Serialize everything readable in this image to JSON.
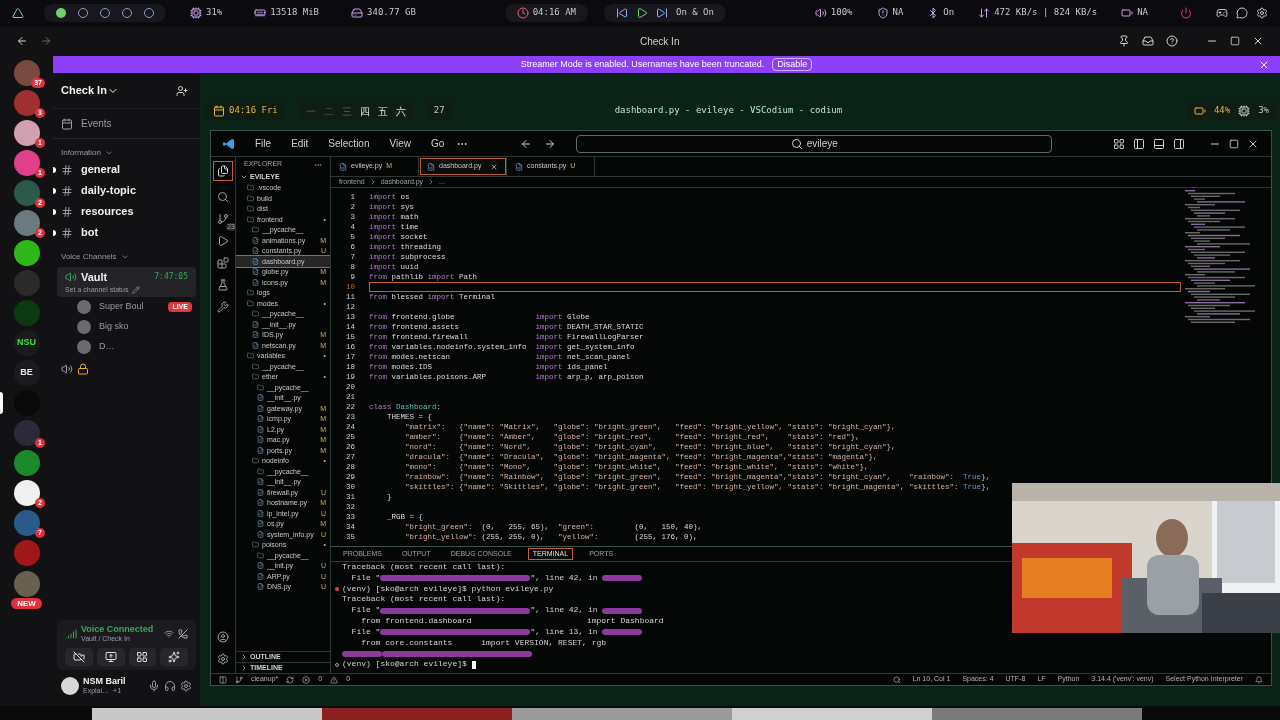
{
  "system_bar": {
    "workspaces": [
      {
        "selected": true
      },
      {
        "selected": false
      },
      {
        "selected": false
      },
      {
        "selected": false
      },
      {
        "selected": false
      }
    ],
    "stats": [
      {
        "kind": "cpu",
        "text": "31%"
      },
      {
        "kind": "memory",
        "text": "13518 MiB"
      },
      {
        "kind": "disk",
        "text": "340.77 GB"
      }
    ],
    "clock": "04:16 AM",
    "media": "On & On",
    "indicators": [
      {
        "kind": "volume",
        "text": "100%"
      },
      {
        "kind": "vpn",
        "text": "NA"
      },
      {
        "kind": "bluetooth",
        "text": "On"
      },
      {
        "kind": "network",
        "text": "472 KB/s | 824 KB/s"
      },
      {
        "kind": "battery",
        "text": "NA"
      }
    ]
  },
  "discord": {
    "window_title": "Check In",
    "banner": {
      "text": "Streamer Mode is enabled. Usernames have been truncated.",
      "button": "Disable"
    },
    "servers": [
      {
        "kind": "avatar",
        "color": "#7a4a40",
        "badge": "37",
        "selected": false
      },
      {
        "kind": "avatar",
        "color": "#a03030",
        "badge": "3",
        "selected": false
      },
      {
        "kind": "avatar",
        "color": "#d0a0b0",
        "badge": "1",
        "selected": false
      },
      {
        "kind": "avatar",
        "color": "#e0408a",
        "badge": "1",
        "selected": false
      },
      {
        "kind": "avatar",
        "color": "#2a5a4a",
        "badge": "2",
        "selected": false
      },
      {
        "kind": "avatar",
        "color": "#6a7a80",
        "badge": "2",
        "selected": false
      },
      {
        "kind": "avatar",
        "color": "#2fb81a",
        "selected": false
      },
      {
        "kind": "avatar",
        "color": "#2a2a2a",
        "selected": false
      },
      {
        "kind": "avatar",
        "color": "#0c3a10",
        "selected": false
      },
      {
        "kind": "text",
        "label": "NSU",
        "color": "#3adf3a",
        "selected": false
      },
      {
        "kind": "text",
        "label": "BE",
        "color": "#e6e6e6",
        "selected": false
      },
      {
        "kind": "avatar",
        "color": "#0a0a0a",
        "selected": true
      },
      {
        "kind": "avatar",
        "color": "#2a2a3a",
        "badge": "1",
        "selected": false
      },
      {
        "kind": "avatar",
        "color": "#1a8a2a",
        "selected": false
      },
      {
        "kind": "avatar",
        "color": "#f0f0f0",
        "badge": "2",
        "selected": false
      },
      {
        "kind": "avatar",
        "color": "#2a5a8a",
        "badge": "7",
        "selected": false
      },
      {
        "kind": "avatar",
        "color": "#a01818",
        "selected": false
      },
      {
        "kind": "avatar",
        "color": "#6a6050",
        "badge": "NEW",
        "selected": false
      }
    ],
    "server_name": "Check In",
    "events": "Events",
    "category": "Information",
    "channels": [
      {
        "name": "general",
        "unread": true
      },
      {
        "name": "daily-topic",
        "unread": true
      },
      {
        "name": "resources",
        "unread": true
      },
      {
        "name": "bot",
        "unread": true
      }
    ],
    "voice": {
      "category": "Voice Channels",
      "channel": "Vault",
      "timer": "7:47:05",
      "status_hint": "Set a channel status",
      "members": [
        {
          "name": "Super Boul",
          "live": true,
          "live_label": "LIVE"
        },
        {
          "name": "Big sko",
          "live": false
        },
        {
          "name": "D…",
          "live": false
        }
      ]
    },
    "voice_panel": {
      "title": "Voice Connected",
      "subtitle": "Vault / Check In"
    },
    "user": {
      "name": "NSM Baril",
      "status": "Explai…",
      "extra": "+1"
    }
  },
  "waybar": {
    "clock": "04:16 Fri",
    "workspaces": [
      {
        "label": "一",
        "occupied": false
      },
      {
        "label": "二",
        "occupied": false
      },
      {
        "label": "三",
        "occupied": false
      },
      {
        "label": "四",
        "occupied": true
      },
      {
        "label": "五",
        "occupied": true
      },
      {
        "label": "六",
        "occupied": true
      }
    ],
    "count": "27",
    "title": "dashboard.py - evileye - VSCodium - codium",
    "battery": "44%",
    "cpu": "3%"
  },
  "vscode": {
    "menu": [
      "File",
      "Edit",
      "Selection",
      "View",
      "Go"
    ],
    "search": "evileye",
    "scm_badge": "23",
    "explorer": {
      "title": "EXPLORER",
      "root": "EVILEYE",
      "sections": [
        "OUTLINE",
        "TIMELINE"
      ],
      "tree": [
        {
          "name": ".vscode",
          "kind": "folder",
          "selected": false
        },
        {
          "name": "build",
          "kind": "folder",
          "selected": false
        },
        {
          "name": "dist",
          "kind": "folder",
          "selected": false
        },
        {
          "name": "frontend",
          "kind": "folder",
          "status": "•",
          "selected": false,
          "children": [
            {
              "name": "__pycache__",
              "kind": "folder",
              "selected": false
            },
            {
              "name": "animations.py",
              "kind": "file",
              "status": "M",
              "selected": false
            },
            {
              "name": "constants.py",
              "kind": "file",
              "status": "U",
              "selected": false
            },
            {
              "name": "dashboard.py",
              "kind": "file",
              "selected": true
            },
            {
              "name": "globe.py",
              "kind": "file",
              "status": "M",
              "selected": false
            },
            {
              "name": "icons.py",
              "kind": "file",
              "status": "M",
              "selected": false
            }
          ]
        },
        {
          "name": "logs",
          "kind": "folder",
          "selected": false
        },
        {
          "name": "modes",
          "kind": "folder",
          "status": "•",
          "selected": false,
          "children": [
            {
              "name": "__pycache__",
              "kind": "folder",
              "selected": false
            },
            {
              "name": "__init__.py",
              "kind": "file",
              "selected": false
            },
            {
              "name": "IDS.py",
              "kind": "file",
              "status": "M",
              "selected": false
            },
            {
              "name": "netscan.py",
              "kind": "file",
              "status": "M",
              "selected": false
            }
          ]
        },
        {
          "name": "variables",
          "kind": "folder",
          "status": "•",
          "selected": false,
          "children": [
            {
              "name": "__pycache__",
              "kind": "folder",
              "selected": false
            },
            {
              "name": "ether",
              "kind": "folder",
              "status": "•",
              "selected": false,
              "children": [
                {
                  "name": "__pycache__",
                  "kind": "folder",
                  "selected": false
                },
                {
                  "name": "__init__.py",
                  "kind": "file",
                  "selected": false
                },
                {
                  "name": "gateway.py",
                  "kind": "file",
                  "status": "M",
                  "selected": false
                },
                {
                  "name": "icmp.py",
                  "kind": "file",
                  "status": "M",
                  "selected": false
                },
                {
                  "name": "L2.py",
                  "kind": "file",
                  "status": "M",
                  "selected": false
                },
                {
                  "name": "mac.py",
                  "kind": "file",
                  "status": "M",
                  "selected": false
                },
                {
                  "name": "ports.py",
                  "kind": "file",
                  "status": "M",
                  "selected": false
                }
              ]
            },
            {
              "name": "nodeinfo",
              "kind": "folder",
              "status": "•",
              "selected": false,
              "children": [
                {
                  "name": "__pycache__",
                  "kind": "folder",
                  "selected": false
                },
                {
                  "name": "__init__.py",
                  "kind": "file",
                  "selected": false
                },
                {
                  "name": "firewall.py",
                  "kind": "file",
                  "status": "U",
                  "selected": false
                },
                {
                  "name": "hostname.py",
                  "kind": "file",
                  "status": "M",
                  "selected": false
                },
                {
                  "name": "ip_intel.py",
                  "kind": "file",
                  "status": "U",
                  "selected": false
                },
                {
                  "name": "os.py",
                  "kind": "file",
                  "status": "M",
                  "selected": false
                },
                {
                  "name": "system_info.py",
                  "kind": "file",
                  "status": "U",
                  "selected": false
                }
              ]
            },
            {
              "name": "poisons",
              "kind": "folder",
              "status": "•",
              "selected": false,
              "children": [
                {
                  "name": "__pycache__",
                  "kind": "folder",
                  "selected": false
                },
                {
                  "name": "__init.py",
                  "kind": "file",
                  "status": "U",
                  "selected": false
                },
                {
                  "name": "ARP.py",
                  "kind": "file",
                  "status": "U",
                  "selected": false
                },
                {
                  "name": "DNS.py",
                  "kind": "file",
                  "status": "U",
                  "selected": false
                }
              ]
            }
          ]
        }
      ]
    },
    "tabs": [
      {
        "label": "evileye.py",
        "status": "M",
        "selected": false
      },
      {
        "label": "dashboard.py",
        "selected": true
      },
      {
        "label": "constants.py",
        "status": "U",
        "selected": false
      }
    ],
    "breadcrumb": [
      "frontend",
      "dashboard.py",
      "..."
    ],
    "code": [
      {
        "n": "1",
        "selected": false,
        "s": [
          {
            "kind": "kw",
            "text": "import"
          },
          {
            "kind": "id",
            "text": " os"
          }
        ]
      },
      {
        "n": "2",
        "selected": false,
        "s": [
          {
            "kind": "kw",
            "text": "import"
          },
          {
            "kind": "id",
            "text": " sys"
          }
        ]
      },
      {
        "n": "3",
        "selected": false,
        "s": [
          {
            "kind": "kw",
            "text": "import"
          },
          {
            "kind": "id",
            "text": " math"
          }
        ]
      },
      {
        "n": "4",
        "selected": false,
        "s": [
          {
            "kind": "kw",
            "text": "import"
          },
          {
            "kind": "id",
            "text": " time"
          }
        ]
      },
      {
        "n": "5",
        "selected": false,
        "s": [
          {
            "kind": "kw",
            "text": "import"
          },
          {
            "kind": "id",
            "text": " socket"
          }
        ]
      },
      {
        "n": "6",
        "selected": false,
        "s": [
          {
            "kind": "kw",
            "text": "import"
          },
          {
            "kind": "id",
            "text": " threading"
          }
        ]
      },
      {
        "n": "7",
        "selected": false,
        "s": [
          {
            "kind": "kw",
            "text": "import"
          },
          {
            "kind": "id",
            "text": " subprocess"
          }
        ]
      },
      {
        "n": "8",
        "selected": false,
        "s": [
          {
            "kind": "kw",
            "text": "import"
          },
          {
            "kind": "id",
            "text": " uuid"
          }
        ]
      },
      {
        "n": "9",
        "selected": false,
        "s": [
          {
            "kind": "kw",
            "text": "from"
          },
          {
            "kind": "id",
            "text": " pathlib "
          },
          {
            "kind": "kw",
            "text": "import"
          },
          {
            "kind": "id",
            "text": " Path"
          }
        ]
      },
      {
        "n": "10",
        "selected": true
      },
      {
        "n": "11",
        "selected": false,
        "s": [
          {
            "kind": "kw",
            "text": "from"
          },
          {
            "kind": "id",
            "text": " blessed "
          },
          {
            "kind": "kw",
            "text": "import"
          },
          {
            "kind": "id",
            "text": " Terminal"
          }
        ]
      },
      {
        "n": "12",
        "selected": false
      },
      {
        "n": "13",
        "selected": false,
        "kind": "aligned",
        "s": [
          {
            "kind": "kw",
            "text": "from"
          },
          {
            "kind": "id",
            "text": " frontend.globe"
          },
          {
            "kind": "kw",
            "text": "import"
          },
          {
            "kind": "id",
            "text": " Globe"
          }
        ]
      },
      {
        "n": "14",
        "selected": false,
        "kind": "aligned",
        "s": [
          {
            "kind": "kw",
            "text": "from"
          },
          {
            "kind": "id",
            "text": " frontend.assets"
          },
          {
            "kind": "kw",
            "text": "import"
          },
          {
            "kind": "id",
            "text": " DEATH_STAR_STATIC"
          }
        ]
      },
      {
        "n": "15",
        "selected": false,
        "kind": "aligned",
        "s": [
          {
            "kind": "kw",
            "text": "from"
          },
          {
            "kind": "id",
            "text": " frontend.firewall"
          },
          {
            "kind": "kw",
            "text": "import"
          },
          {
            "kind": "id",
            "text": " FirewallLogParser"
          }
        ]
      },
      {
        "n": "16",
        "selected": false,
        "kind": "aligned",
        "s": [
          {
            "kind": "kw",
            "text": "from"
          },
          {
            "kind": "id",
            "text": " variables.nodeinfo.system_info"
          },
          {
            "kind": "kw",
            "text": "import"
          },
          {
            "kind": "id",
            "text": " get_system_info"
          }
        ]
      },
      {
        "n": "17",
        "selected": false,
        "kind": "aligned",
        "s": [
          {
            "kind": "kw",
            "text": "from"
          },
          {
            "kind": "id",
            "text": " modes.netscan"
          },
          {
            "kind": "kw",
            "text": "import"
          },
          {
            "kind": "id",
            "text": " net_scan_panel"
          }
        ]
      },
      {
        "n": "18",
        "selected": false,
        "kind": "aligned",
        "s": [
          {
            "kind": "kw",
            "text": "from"
          },
          {
            "kind": "id",
            "text": " modes.IDS"
          },
          {
            "kind": "kw",
            "text": "import"
          },
          {
            "kind": "id",
            "text": " ids_panel"
          }
        ]
      },
      {
        "n": "19",
        "selected": false,
        "kind": "aligned",
        "s": [
          {
            "kind": "kw",
            "text": "from"
          },
          {
            "kind": "id",
            "text": " variables.poisons.ARP"
          },
          {
            "kind": "kw",
            "text": "import"
          },
          {
            "kind": "id",
            "text": " arp_p, arp_poison"
          }
        ]
      },
      {
        "n": "20",
        "selected": false
      },
      {
        "n": "21",
        "selected": false
      },
      {
        "n": "22",
        "selected": false,
        "s": [
          {
            "kind": "kw",
            "text": "class"
          },
          {
            "kind": "cls",
            "text": " Dashboard"
          },
          {
            "kind": "id",
            "text": ":"
          }
        ]
      },
      {
        "n": "23",
        "selected": false,
        "s": [
          {
            "kind": "id",
            "text": "    THEMES = {"
          }
        ]
      },
      {
        "n": "24",
        "selected": false,
        "s": [
          {
            "kind": "str",
            "text": "        \"matrix\":   {\"name\": \"Matrix\",   \"globe\": \"bright_green\",   \"feed\": \"bright_yellow\", \"stats\": \"bright_cyan\"},"
          }
        ]
      },
      {
        "n": "25",
        "selected": false,
        "s": [
          {
            "kind": "str",
            "text": "        \"amber\":    {\"name\": \"Amber\",    \"globe\": \"bright_red\",     \"feed\": \"bright_red\",    \"stats\": \"red\"},"
          }
        ]
      },
      {
        "n": "26",
        "selected": false,
        "s": [
          {
            "kind": "str",
            "text": "        \"nord\":     {\"name\": \"Nord\",     \"globe\": \"bright_cyan\",    \"feed\": \"bright_blue\",   \"stats\": \"bright_cyan\"},"
          }
        ]
      },
      {
        "n": "27",
        "selected": false,
        "s": [
          {
            "kind": "str",
            "text": "        \"dracula\":  {\"name\": \"Dracula\",  \"globe\": \"bright_magenta\", \"feed\": \"bright_magenta\",\"stats\": \"magenta\"},"
          }
        ]
      },
      {
        "n": "28",
        "selected": false,
        "s": [
          {
            "kind": "str",
            "text": "        \"mono\":     {\"name\": \"Mono\",     \"globe\": \"bright_white\",   \"feed\": \"bright_white\",  \"stats\": \"white\"},"
          }
        ]
      },
      {
        "n": "29",
        "selected": false,
        "s": [
          {
            "kind": "str",
            "text": "        \"rainbow\":  {\"name\": \"Rainbow\",  \"globe\": \"bright_green\",   \"feed\": \"bright_magenta\",\"stats\": \"bright_cyan\",    \"rainbow\":  "
          },
          {
            "kind": "bool",
            "text": "True"
          },
          {
            "kind": "str",
            "text": "},"
          }
        ]
      },
      {
        "n": "30",
        "selected": false,
        "s": [
          {
            "kind": "str",
            "text": "        \"skittles\": {\"name\": \"Skittles\", \"globe\": \"bright_green\",   \"feed\": \"bright_yellow\", \"stats\": \"bright_magenta\", \"skittles\": "
          },
          {
            "kind": "bool",
            "text": "True"
          },
          {
            "kind": "str",
            "text": "},"
          }
        ]
      },
      {
        "n": "31",
        "selected": false,
        "s": [
          {
            "kind": "id",
            "text": "    }"
          }
        ]
      },
      {
        "n": "32",
        "selected": false
      },
      {
        "n": "33",
        "selected": false,
        "s": [
          {
            "kind": "id",
            "text": "    _RGB = {"
          }
        ]
      },
      {
        "n": "34",
        "selected": false,
        "s": [
          {
            "kind": "str",
            "text": "        \"bright_green\":  "
          },
          {
            "kind": "id",
            "text": "(0,   255, 65),  "
          },
          {
            "kind": "str",
            "text": "\"green\":         "
          },
          {
            "kind": "id",
            "text": "(0,   150, 40),"
          }
        ]
      },
      {
        "n": "35",
        "selected": false,
        "s": [
          {
            "kind": "str",
            "text": "        \"bright_yellow\": "
          },
          {
            "kind": "id",
            "text": "(255, 255, 0),   "
          },
          {
            "kind": "str",
            "text": "\"yellow\":        "
          },
          {
            "kind": "id",
            "text": "(255, 176, 0),"
          }
        ]
      }
    ],
    "panel_tabs": [
      {
        "label": "PROBLEMS",
        "selected": false
      },
      {
        "label": "OUTPUT",
        "selected": false
      },
      {
        "label": "DEBUG CONSOLE",
        "selected": false
      },
      {
        "label": "TERMINAL",
        "selected": true
      },
      {
        "label": "PORTS",
        "selected": false
      }
    ],
    "terminal": [
      {
        "kind": "plain",
        "s": [
          {
            "kind": "text",
            "text": "Traceback (most recent call last):"
          }
        ]
      },
      {
        "kind": "plain",
        "s": [
          {
            "kind": "text",
            "text": "  File \""
          },
          {
            "kind": "path"
          },
          {
            "kind": "text",
            "text": "\", line 42, in "
          },
          {
            "kind": "word"
          }
        ]
      },
      {
        "kind": "error",
        "s": [
          {
            "kind": "text",
            "text": "(venv) [sko@arch evileye]$ python evileye.py"
          }
        ]
      },
      {
        "kind": "plain",
        "s": [
          {
            "kind": "text",
            "text": "Traceback (most recent call last):"
          }
        ]
      },
      {
        "kind": "plain",
        "s": [
          {
            "kind": "text",
            "text": "  File \""
          },
          {
            "kind": "path"
          },
          {
            "kind": "text",
            "text": "\", line 42, in "
          },
          {
            "kind": "word"
          }
        ]
      },
      {
        "kind": "plain",
        "s": [
          {
            "kind": "text",
            "text": "    from frontend.dashboard                        import Dashboard"
          }
        ]
      },
      {
        "kind": "plain",
        "s": [
          {
            "kind": "text",
            "text": "  File \""
          },
          {
            "kind": "path"
          },
          {
            "kind": "text",
            "text": "\", line 13, in "
          },
          {
            "kind": "word"
          }
        ]
      },
      {
        "kind": "plain",
        "s": [
          {
            "kind": "text",
            "text": "    from core.constants      import VERSION, RESET, rgb"
          }
        ]
      },
      {
        "kind": "plain",
        "s": [
          {
            "kind": "word"
          },
          {
            "kind": "path"
          }
        ]
      },
      {
        "kind": "idle",
        "cursor": true,
        "s": [
          {
            "kind": "text",
            "text": "(venv) [sko@arch evileye]$ "
          }
        ]
      }
    ],
    "status": {
      "branch": "cleanup*",
      "errors": "0",
      "warnings": "0",
      "items": [
        "Ln 10, Col 1",
        "Spaces: 4",
        "UTF-8",
        "LF",
        "Python",
        "3.14.4 ('venv': venv)",
        "Select Python Interpreter"
      ]
    }
  }
}
